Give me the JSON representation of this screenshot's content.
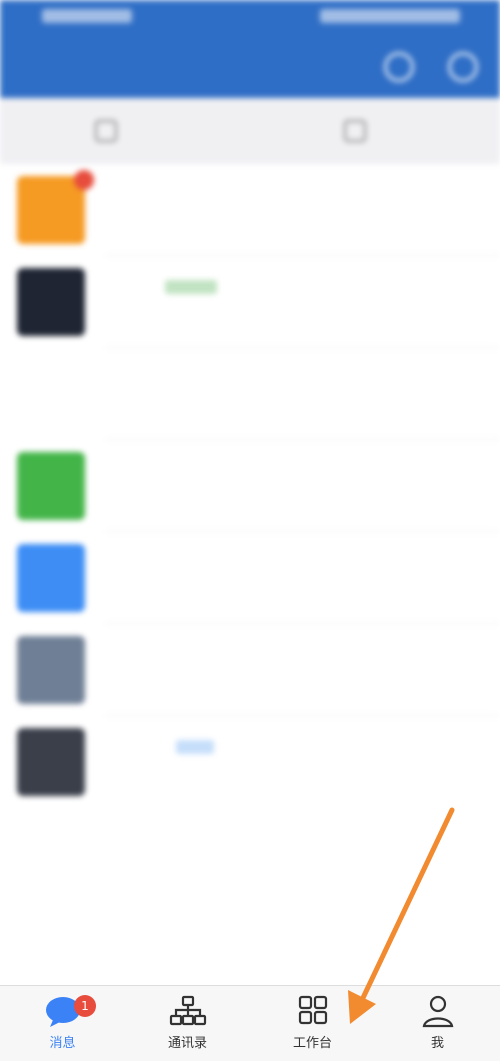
{
  "status_bar": {
    "left_text": "",
    "right_text": ""
  },
  "header": {
    "title": ""
  },
  "toolbar": {
    "left_label": "",
    "right_label": ""
  },
  "conversations": [
    {
      "avatar_color": "#f59a23",
      "name": "",
      "preview": "",
      "time": "",
      "badge": true
    },
    {
      "avatar_color": "#1f2533",
      "name": "",
      "preview": "",
      "time": "",
      "tag_color": "#4caf50"
    },
    {
      "avatar_color": "#ffffff",
      "name": "",
      "preview": "",
      "time": ""
    },
    {
      "avatar_color": "#43b548",
      "name": "",
      "preview": "",
      "time": ""
    },
    {
      "avatar_color": "#3d8df5",
      "name": "",
      "preview": "",
      "time": ""
    },
    {
      "avatar_color": "#6f7f95",
      "name": "",
      "preview": "",
      "time": ""
    },
    {
      "avatar_color": "#3a3f4a",
      "name": "",
      "preview": "",
      "time": "",
      "tag_color": "#5aa0f0"
    }
  ],
  "tabbar": {
    "tabs": [
      {
        "label": "消息",
        "icon": "chat-bubble-icon",
        "active": true,
        "badge": "1"
      },
      {
        "label": "通讯录",
        "icon": "org-chart-icon",
        "active": false
      },
      {
        "label": "工作台",
        "icon": "grid-icon",
        "active": false
      },
      {
        "label": "我",
        "icon": "person-icon",
        "active": false
      }
    ]
  },
  "colors": {
    "header_bg": "#2f6ec6",
    "tab_active": "#3b82f6",
    "badge": "#e74c3c",
    "annotation_arrow": "#f28a30"
  }
}
